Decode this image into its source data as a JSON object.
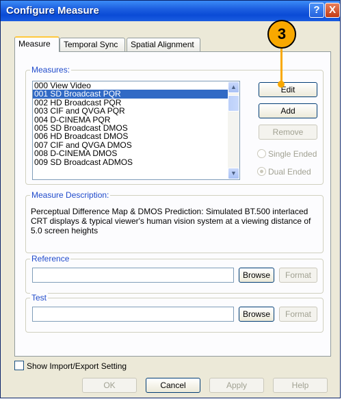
{
  "window": {
    "title": "Configure Measure",
    "help_label": "?",
    "close_label": "X"
  },
  "tabs": [
    {
      "label": "Measure"
    },
    {
      "label": "Temporal Sync"
    },
    {
      "label": "Spatial Alignment"
    }
  ],
  "measures": {
    "group_label": "Measures:",
    "items": [
      "000 View Video",
      "001 SD Broadcast PQR",
      "002 HD Broadcast PQR",
      "003 CIF and QVGA PQR",
      "004 D-CINEMA PQR",
      "005 SD Broadcast DMOS",
      "006 HD Broadcast DMOS",
      "007 CIF and QVGA DMOS",
      "008 D-CINEMA DMOS",
      "009 SD Broadcast ADMOS"
    ],
    "selected_index": 1,
    "buttons": {
      "edit": "Edit",
      "add": "Add",
      "remove": "Remove"
    },
    "radios": {
      "single": "Single Ended",
      "dual": "Dual Ended",
      "selected": "dual"
    }
  },
  "description": {
    "group_label": "Measure Description:",
    "text": "Perceptual Difference Map & DMOS  Prediction:  Simulated BT.500 interlaced CRT displays & typical viewer's human vision system at a viewing distance of 5.0 screen heights"
  },
  "reference": {
    "group_label": "Reference",
    "value": "",
    "browse_label": "Browse",
    "format_label": "Format"
  },
  "test": {
    "group_label": "Test",
    "value": "",
    "browse_label": "Browse",
    "format_label": "Format"
  },
  "options": {
    "show_import_export_label": "Show Import/Export Setting",
    "show_import_export_checked": false
  },
  "footer": {
    "ok": "OK",
    "cancel": "Cancel",
    "apply": "Apply",
    "help": "Help"
  },
  "callout": {
    "label": "3"
  },
  "colors": {
    "titlebar": "#0a4bd6",
    "selection": "#316ac5",
    "callout": "#f8a800"
  }
}
